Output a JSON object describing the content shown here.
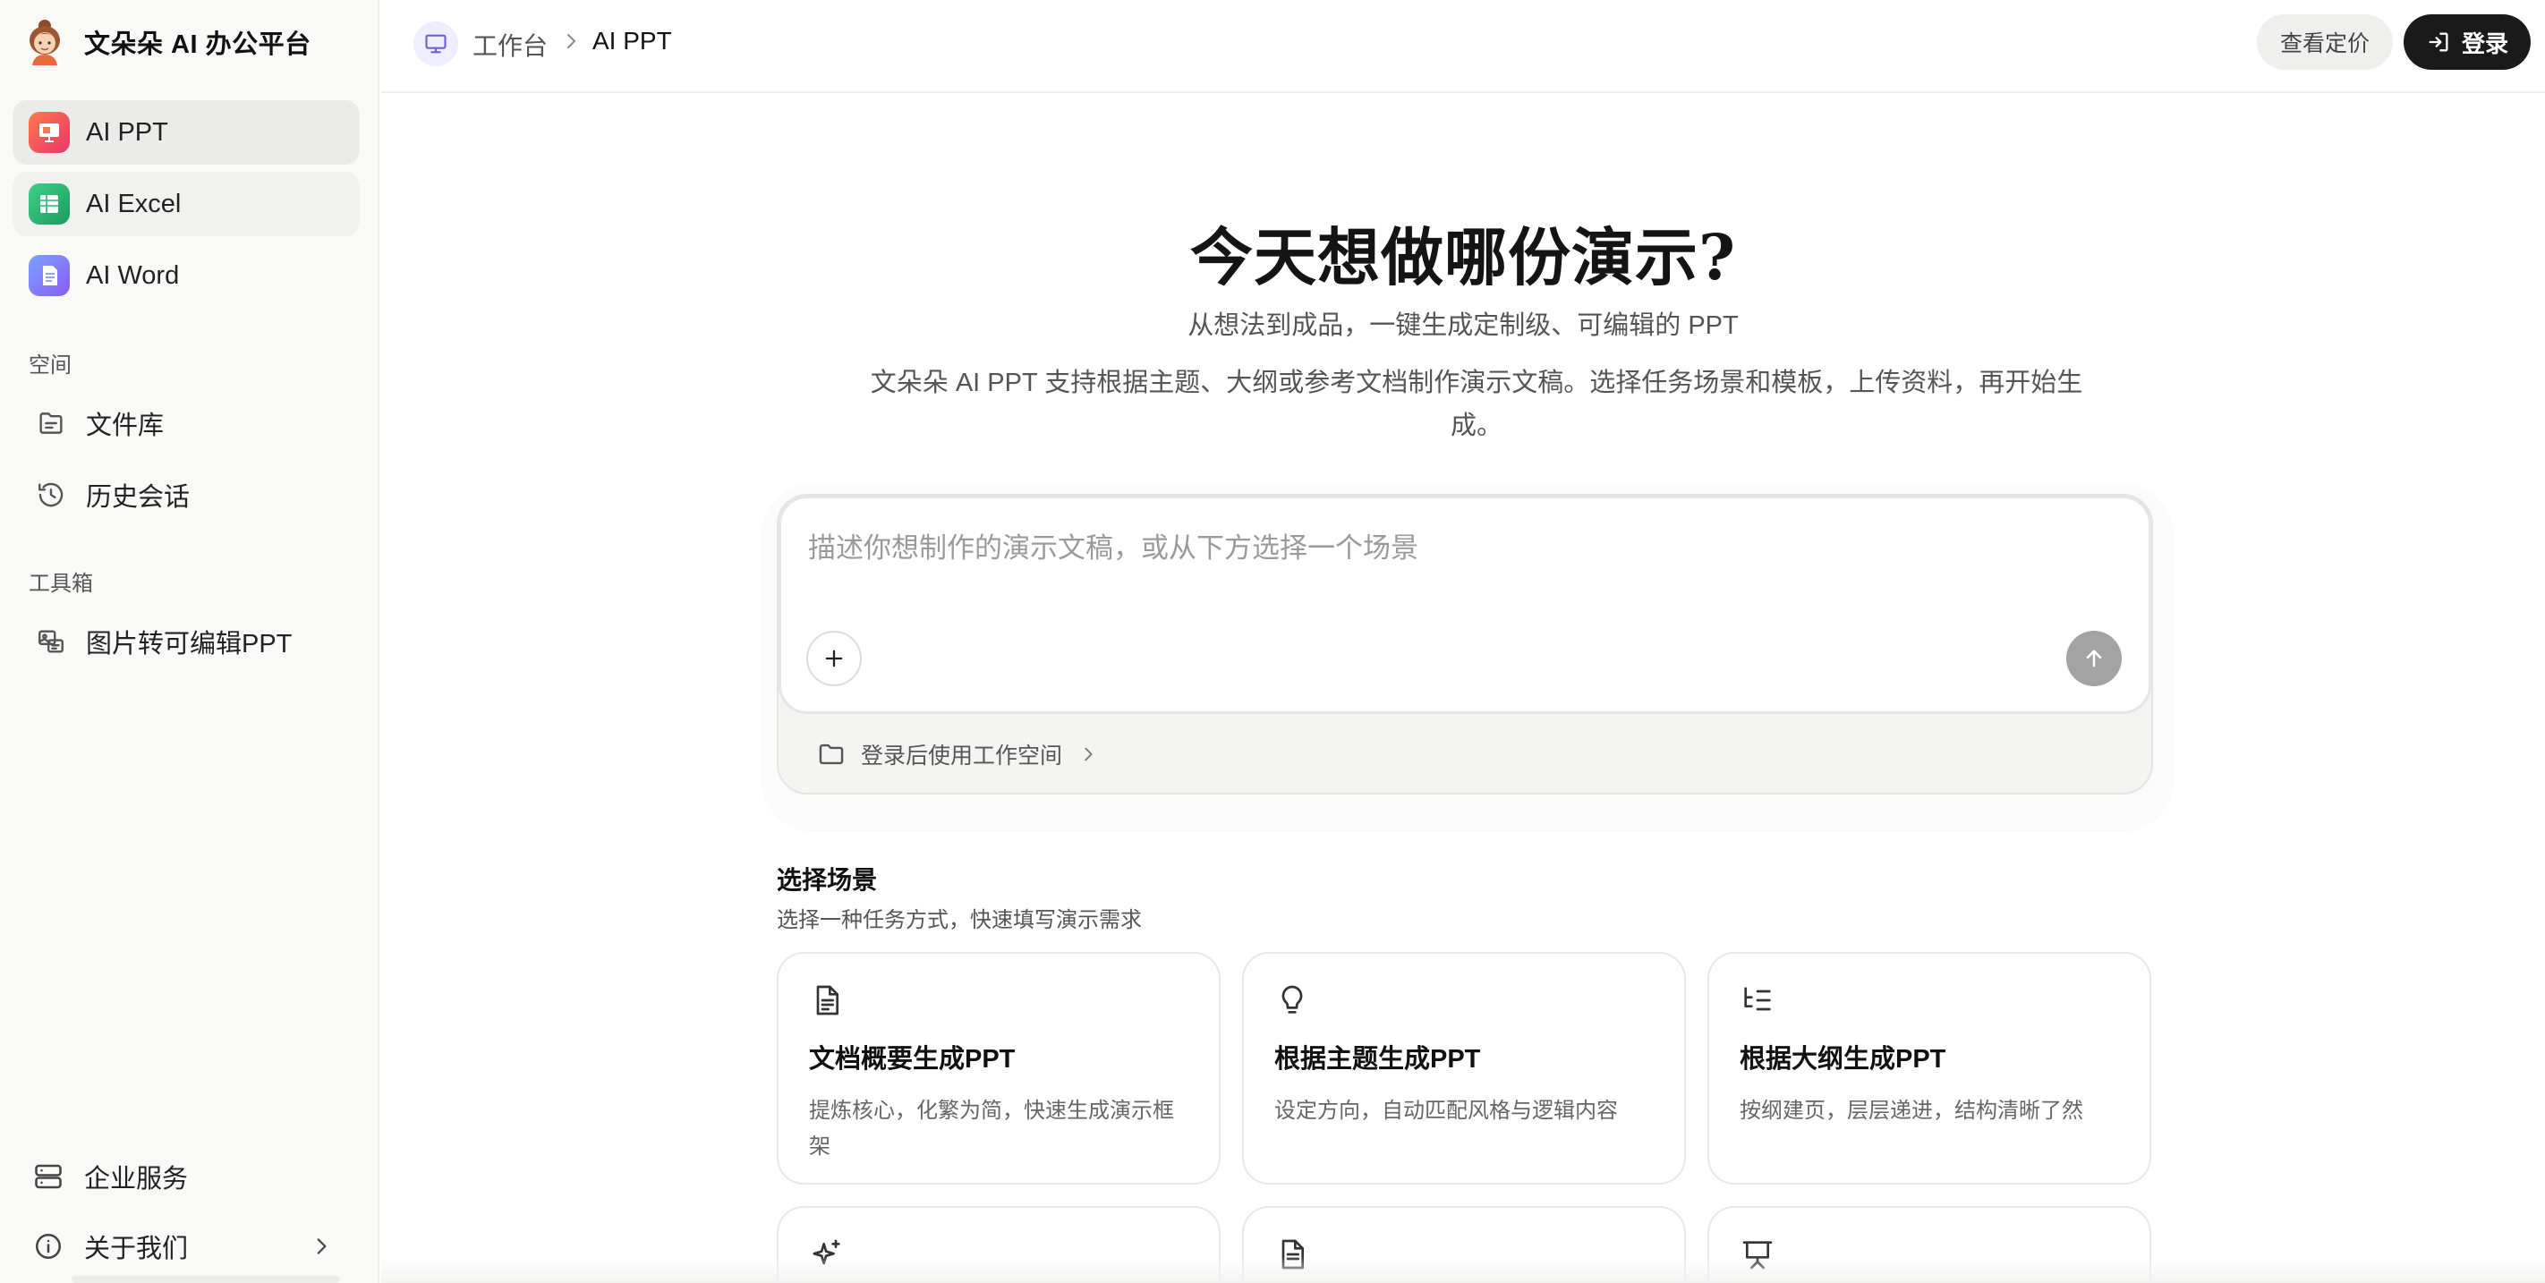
{
  "brand": {
    "name": "文朵朵 AI 办公平台"
  },
  "sidebar": {
    "apps": [
      {
        "label": "AI PPT",
        "icon": "ppt-app-icon",
        "color": "#ef5a3a"
      },
      {
        "label": "AI Excel",
        "icon": "excel-app-icon",
        "color": "#2bb673"
      },
      {
        "label": "AI Word",
        "icon": "word-app-icon",
        "color": "#4a7cf0"
      }
    ],
    "space_label": "空间",
    "space_items": [
      {
        "label": "文件库",
        "icon": "folder-library-icon"
      },
      {
        "label": "历史会话",
        "icon": "history-icon"
      }
    ],
    "toolbox_label": "工具箱",
    "toolbox_items": [
      {
        "label": "图片转可编辑PPT",
        "icon": "image-convert-icon"
      }
    ],
    "bottom_items": [
      {
        "label": "企业服务",
        "icon": "server-icon"
      },
      {
        "label": "关于我们",
        "icon": "info-icon"
      }
    ]
  },
  "header": {
    "breadcrumb_root": "工作台",
    "breadcrumb_current": "AI PPT",
    "pricing_label": "查看定价",
    "login_label": "登录"
  },
  "hero": {
    "title": "今天想做哪份演示?",
    "subtitle": "从想法到成品，一键生成定制级、可编辑的 PPT",
    "description": "文朵朵 AI PPT 支持根据主题、大纲或参考文档制作演示文稿。选择任务场景和模板，上传资料，再开始生成。"
  },
  "composer": {
    "placeholder": "描述你想制作的演示文稿，或从下方选择一个场景",
    "value": "",
    "workspace_link": "登录后使用工作空间"
  },
  "scenes": {
    "title": "选择场景",
    "subtitle": "选择一种任务方式，快速填写演示需求",
    "cards": [
      {
        "title": "文档概要生成PPT",
        "desc": "提炼核心，化繁为简，快速生成演示框架",
        "icon": "document-icon"
      },
      {
        "title": "根据主题生成PPT",
        "desc": "设定方向，自动匹配风格与逻辑内容",
        "icon": "lightbulb-icon"
      },
      {
        "title": "根据大纲生成PPT",
        "desc": "按纲建页，层层递进，结构清晰了然",
        "icon": "outline-icon"
      },
      {
        "title": "",
        "desc": "",
        "icon": "sparkles-icon"
      },
      {
        "title": "",
        "desc": "",
        "icon": "file-text-icon"
      },
      {
        "title": "",
        "desc": "",
        "icon": "presentation-icon"
      }
    ]
  }
}
